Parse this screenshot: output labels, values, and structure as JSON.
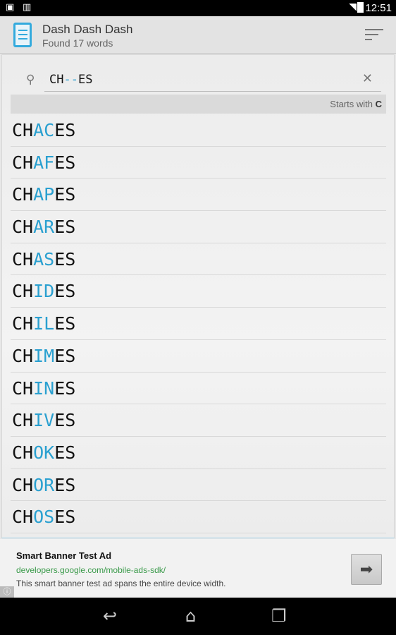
{
  "status_bar": {
    "time": "12:51",
    "icons": [
      "shopping-bag-icon",
      "barcode-icon",
      "wifi-icon",
      "battery-charging-icon"
    ]
  },
  "action_bar": {
    "title": "Dash Dash Dash",
    "subtitle": "Found 17 words",
    "icon": "notepad-icon",
    "menu_icon": "sort-icon"
  },
  "search": {
    "value": "CH--ES",
    "prefix": "CH",
    "blanks": "--",
    "suffix": "ES"
  },
  "filter": {
    "label": "Starts with",
    "letter": "C"
  },
  "words": [
    {
      "pre": "CH",
      "mid": "AC",
      "post": "ES"
    },
    {
      "pre": "CH",
      "mid": "AF",
      "post": "ES"
    },
    {
      "pre": "CH",
      "mid": "AP",
      "post": "ES"
    },
    {
      "pre": "CH",
      "mid": "AR",
      "post": "ES"
    },
    {
      "pre": "CH",
      "mid": "AS",
      "post": "ES"
    },
    {
      "pre": "CH",
      "mid": "ID",
      "post": "ES"
    },
    {
      "pre": "CH",
      "mid": "IL",
      "post": "ES"
    },
    {
      "pre": "CH",
      "mid": "IM",
      "post": "ES"
    },
    {
      "pre": "CH",
      "mid": "IN",
      "post": "ES"
    },
    {
      "pre": "CH",
      "mid": "IV",
      "post": "ES"
    },
    {
      "pre": "CH",
      "mid": "OK",
      "post": "ES"
    },
    {
      "pre": "CH",
      "mid": "OR",
      "post": "ES"
    },
    {
      "pre": "CH",
      "mid": "OS",
      "post": "ES"
    }
  ],
  "ad": {
    "headline": "Smart Banner Test Ad",
    "url": "developers.google.com/mobile-ads-sdk/",
    "description": "This smart banner test ad spans the entire device width."
  },
  "colors": {
    "accent": "#2aa0d0",
    "link": "#3a9a4a"
  }
}
